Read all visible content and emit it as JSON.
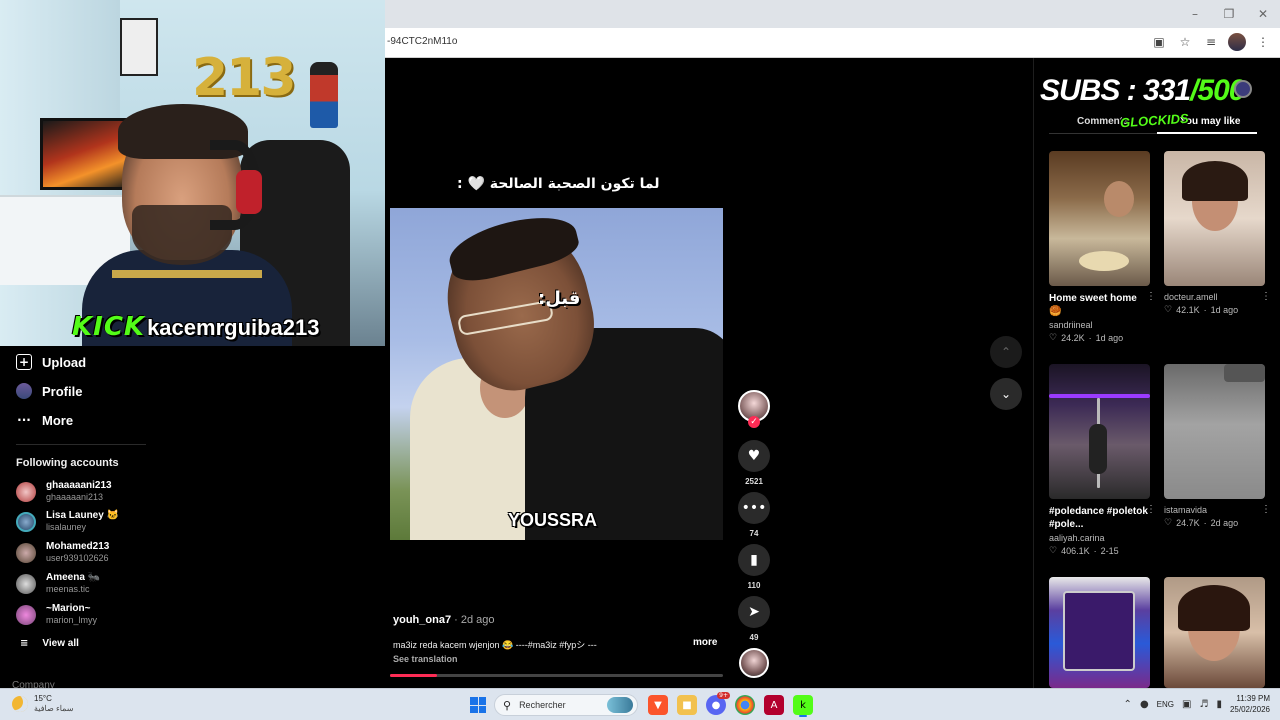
{
  "browser": {
    "url_fragment": "-94CTC2nM11o",
    "window_controls": [
      "minimize-icon",
      "restore-icon",
      "close-icon"
    ],
    "toolbar_icons": [
      "install-app-icon",
      "bookmark-star-icon",
      "reading-list-icon",
      "profile-avatar",
      "kebab-menu-icon"
    ]
  },
  "stream_overlay": {
    "kick_logo": "KICK",
    "kick_username": "kacemrguiba213",
    "balloons": "213",
    "subs_label": "SUBS : 331/500",
    "subs_current": "331",
    "subs_goal": "/500",
    "subs_prefix": "SUBS : ",
    "glock_tag": "GLOCKIDS"
  },
  "sidebar": {
    "items": [
      {
        "label": "Upload",
        "icon": "upload-icon"
      },
      {
        "label": "Profile",
        "icon": "profile-icon"
      },
      {
        "label": "More",
        "icon": "more-icon"
      }
    ],
    "following_title": "Following accounts",
    "accounts": [
      {
        "name": "ghaaaaani213",
        "username": "ghaaaaani213"
      },
      {
        "name": "Lisa Launey 🐱",
        "username": "lisalauney"
      },
      {
        "name": "Mohamed213",
        "username": "user939102626"
      },
      {
        "name": "Ameena 🐜",
        "username": "meenas.tic"
      },
      {
        "name": "~Marion~",
        "username": "marion_lmyy"
      }
    ],
    "view_all": "View all",
    "company": "Company"
  },
  "video": {
    "top_caption": "لما تكون الصحبة الصالحة 🤍 :",
    "label_before": "قبل:",
    "label_name": "YOUSSRA",
    "author": "youh_ona7",
    "time_ago": " · 2d ago",
    "description": "ma3iz reda kacem wjenjon 😂 ----#ma3iz #fypシ ---",
    "more": "more",
    "see_translation": "See translation",
    "progress_fraction": 0.14
  },
  "actions": {
    "likes": "2521",
    "comments": "74",
    "saves": "110",
    "shares": "49"
  },
  "right_panel": {
    "tab_comments": "Comments",
    "tab_you_may_like": "You may like",
    "cards": [
      {
        "title": "Home sweet home 🥮",
        "user": "sandriineal",
        "likes": "24.2K",
        "ago": "1d ago"
      },
      {
        "title": "",
        "user": "docteur.amell",
        "likes": "42.1K",
        "ago": "1d ago"
      },
      {
        "title": "#poledance #poletok #pole...",
        "user": "aaliyah.carina",
        "likes": "406.1K",
        "ago": "2-15"
      },
      {
        "title": "",
        "user": "istamavida",
        "likes": "24.7K",
        "ago": "2d ago"
      },
      {
        "title": "",
        "user": "",
        "likes": "",
        "ago": ""
      },
      {
        "title": "",
        "user": "",
        "likes": "",
        "ago": ""
      }
    ]
  },
  "taskbar": {
    "temperature": "15°C",
    "weather_condition": "سماء صافية",
    "search_placeholder": "Rechercher",
    "language": "ENG",
    "time": "11:39 PM",
    "date": "25/02/2026",
    "discord_badge": "9+"
  }
}
